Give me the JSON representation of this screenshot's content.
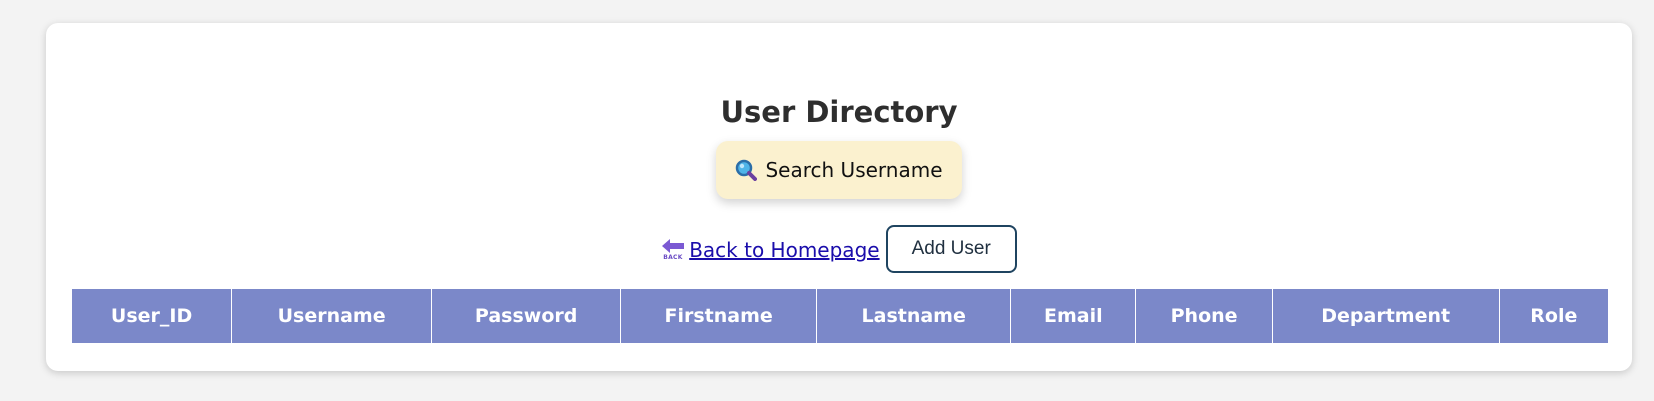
{
  "page": {
    "title": "User Directory"
  },
  "search": {
    "label": "Search Username",
    "icon": "magnifier-icon"
  },
  "actions": {
    "back_label": "Back to Homepage",
    "back_icon_text": "BACK",
    "add_user_label": "Add User"
  },
  "table": {
    "headers": [
      "User_ID",
      "Username",
      "Password",
      "Firstname",
      "Lastname",
      "Email",
      "Phone",
      "Department",
      "Role"
    ]
  },
  "colors": {
    "header_bg": "#7b88c9",
    "search_bg": "#fbf1cf",
    "link": "#1a0dab",
    "add_border": "#1f4460"
  }
}
